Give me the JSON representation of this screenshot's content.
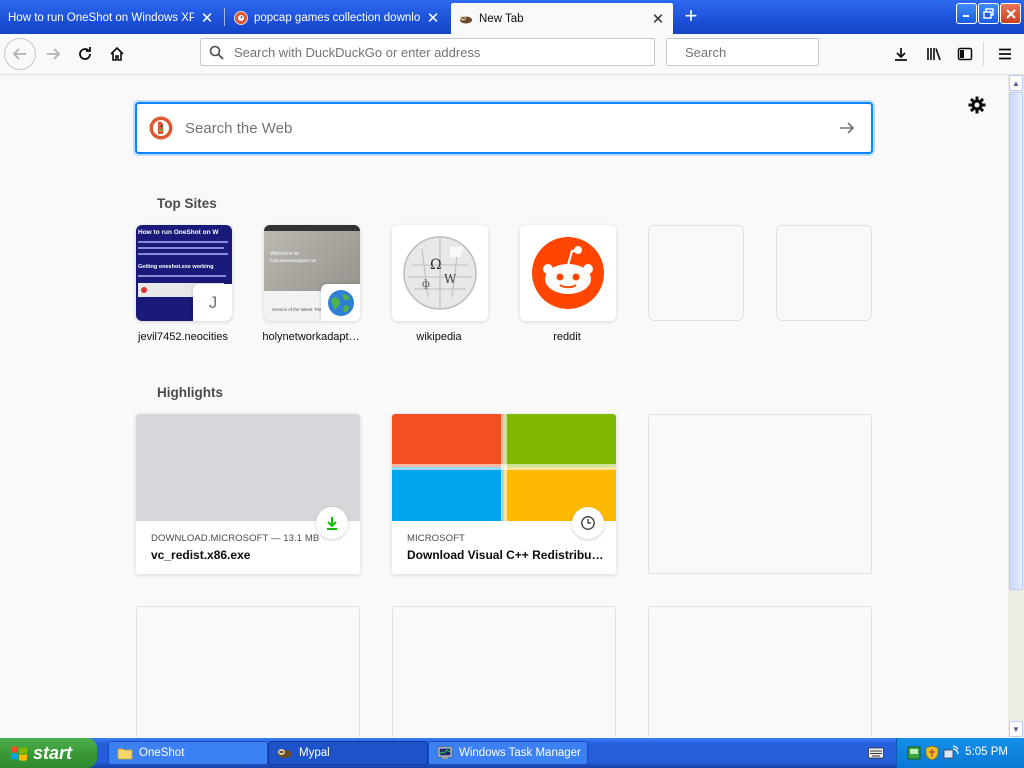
{
  "browser": {
    "tabs": [
      {
        "title": "How to run OneShot on Windows XP",
        "favicon": "none"
      },
      {
        "title": "popcap games collection download",
        "favicon": "duckduckgo-icon"
      },
      {
        "title": "New Tab",
        "favicon": "ferret-icon",
        "active": true
      }
    ],
    "url_placeholder": "Search with DuckDuckGo or enter address",
    "search_placeholder": "Search"
  },
  "newtab": {
    "web_search_placeholder": "Search the Web",
    "top_sites_title": "Top Sites",
    "top_sites": [
      {
        "label": "jevil7452.neocities",
        "corner_letter": "J",
        "thumb_heading": "How to run OneShot on W",
        "thumb_subheading": "Getting oneshot.exe working"
      },
      {
        "label": "holynetworkadapt…",
        "thumb_heading": "Welcome to",
        "thumb_sub": "holynetworkadapter.net",
        "thumb_caption": "Service of the Week: Ptaq"
      },
      {
        "label": "wikipedia"
      },
      {
        "label": "reddit"
      },
      {
        "label": ""
      },
      {
        "label": ""
      }
    ],
    "highlights_title": "Highlights",
    "highlights": [
      {
        "source": "DOWNLOAD.MICROSOFT — 13.1 MB",
        "title": "vc_redist.x86.exe",
        "badge": "download-icon"
      },
      {
        "source": "MICROSOFT",
        "title": "Download Visual C++ Redistribu…",
        "badge": "clock-icon"
      }
    ]
  },
  "taskbar": {
    "start_label": "start",
    "items": [
      {
        "label": "OneShot"
      },
      {
        "label": "Mypal"
      },
      {
        "label": "Windows Task Manager"
      }
    ],
    "clock": "5:05 PM"
  }
}
